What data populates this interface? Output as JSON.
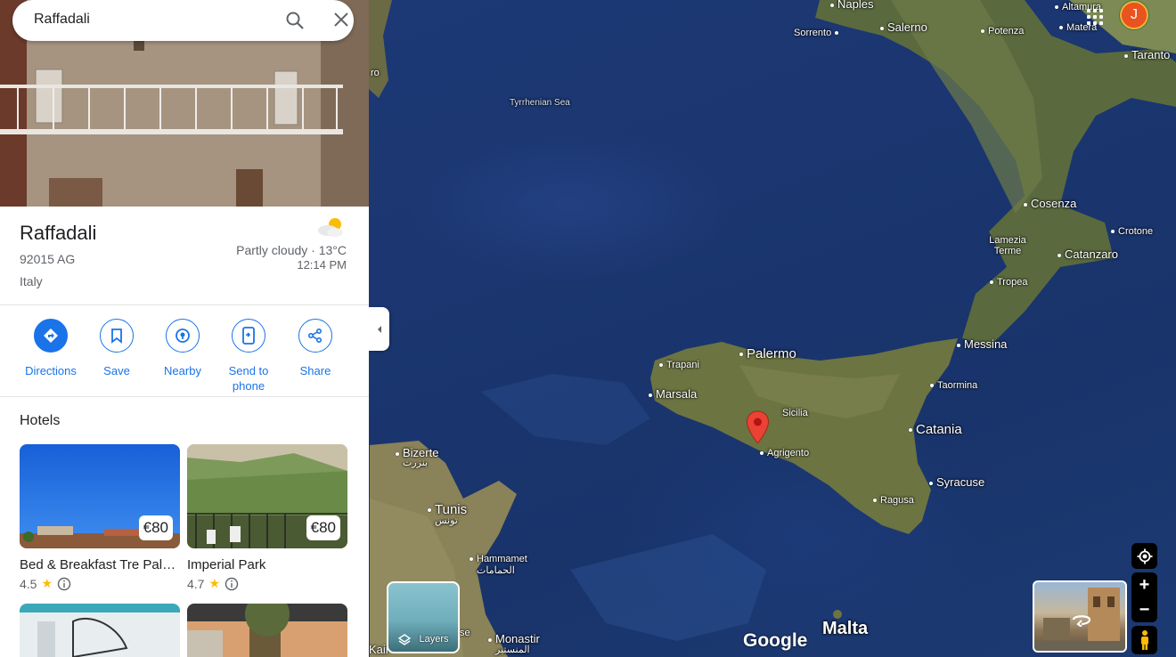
{
  "search": {
    "value": "Raffadali"
  },
  "place": {
    "title": "Raffadali",
    "postal": "92015 AG",
    "country": "Italy",
    "weather": "Partly cloudy · 13°C",
    "time": "12:14 PM"
  },
  "actions": [
    {
      "label": "Directions",
      "icon": "directions-icon"
    },
    {
      "label": "Save",
      "icon": "bookmark-icon"
    },
    {
      "label": "Nearby",
      "icon": "nearby-icon"
    },
    {
      "label": "Send to phone",
      "icon": "send-to-phone-icon"
    },
    {
      "label": "Share",
      "icon": "share-icon"
    }
  ],
  "hotels": {
    "heading": "Hotels",
    "items": [
      {
        "name": "Bed & Breakfast Tre Palme",
        "price": "€80",
        "rating": "4.5"
      },
      {
        "name": "Imperial Park",
        "price": "€80",
        "rating": "4.7"
      }
    ]
  },
  "map": {
    "labels": {
      "naples": "Naples",
      "salerno": "Salerno",
      "sorrento": "Sorrento",
      "potenza": "Potenza",
      "altamura": "Altamura",
      "matera": "Matera",
      "taranto": "Taranto",
      "tyrrhenian": "Tyrrhenian Sea",
      "cosenza": "Cosenza",
      "crotone": "Crotone",
      "lamezia": "Lamezia Terme",
      "catanzaro": "Catanzaro",
      "tropea": "Tropea",
      "messina": "Messina",
      "palermo": "Palermo",
      "trapani": "Trapani",
      "marsala": "Marsala",
      "taormina": "Taormina",
      "sicilia": "Sicilia",
      "catania": "Catania",
      "agrigento": "Agrigento",
      "syracuse": "Syracuse",
      "ragusa": "Ragusa",
      "bizerte": "Bizerte",
      "bizerte_ar": "بنزرت",
      "tunis": "Tunis",
      "tunis_ar": "تونس",
      "hammamet": "Hammamet",
      "hammamet_ar": "الحمامات",
      "monastir": "Monastir",
      "monastir_ar": "المنستير",
      "malta": "Malta",
      "kair": "Kair",
      "ro": "ro",
      "se": "se"
    },
    "logo": "Google",
    "layers_label": "Layers",
    "avatar_initial": "J",
    "accent": "#1a73e8",
    "pin_color": "#ea4335"
  }
}
